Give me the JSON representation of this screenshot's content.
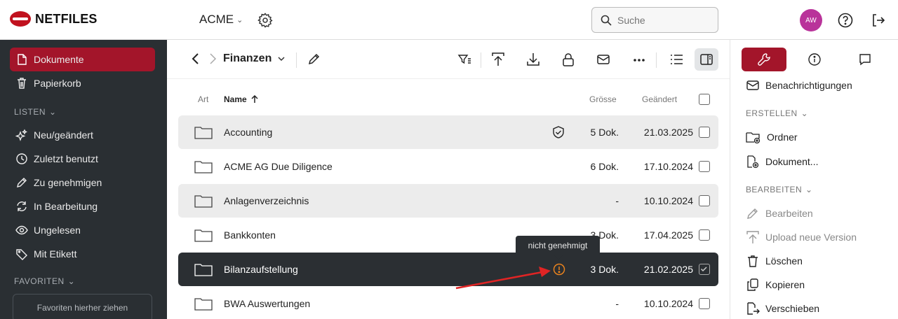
{
  "header": {
    "logo_text": "NETFILES",
    "org_name": "ACME",
    "search_placeholder": "Suche",
    "avatar_initials": "AW"
  },
  "sidebar": {
    "items": [
      {
        "label": "Dokumente",
        "icon": "document-icon",
        "active": true
      },
      {
        "label": "Papierkorb",
        "icon": "trash-icon"
      }
    ],
    "lists_heading": "LISTEN",
    "lists": [
      {
        "label": "Neu/geändert",
        "icon": "sparkle-icon"
      },
      {
        "label": "Zuletzt benutzt",
        "icon": "clock-icon"
      },
      {
        "label": "Zu genehmigen",
        "icon": "pencil-icon"
      },
      {
        "label": "In Bearbeitung",
        "icon": "sync-icon"
      },
      {
        "label": "Ungelesen",
        "icon": "eye-icon"
      },
      {
        "label": "Mit Etikett",
        "icon": "tag-icon"
      }
    ],
    "favorites_heading": "FAVORITEN",
    "favorites_dropzone": "Favoriten hierher ziehen"
  },
  "main": {
    "breadcrumb": "Finanzen",
    "columns": {
      "type": "Art",
      "name": "Name",
      "size": "Grösse",
      "changed": "Geändert"
    },
    "rows": [
      {
        "name": "Accounting",
        "size": "5 Dok.",
        "date": "21.03.2025",
        "status_icon": "shield-check-icon"
      },
      {
        "name": "ACME AG Due Diligence",
        "size": "6 Dok.",
        "date": "17.10.2024"
      },
      {
        "name": "Anlagenverzeichnis",
        "size": "-",
        "date": "10.10.2024"
      },
      {
        "name": "Bankkonten",
        "size": "3 Dok.",
        "date": "17.04.2025"
      },
      {
        "name": "Bilanzaufstellung",
        "size": "3 Dok.",
        "date": "21.02.2025",
        "status_icon": "warning-circle-icon",
        "selected": true
      },
      {
        "name": "BWA Auswertungen",
        "size": "-",
        "date": "10.10.2024"
      }
    ],
    "tooltip": "nicht genehmigt"
  },
  "rpanel": {
    "notifications": "Benachrichtigungen",
    "create_heading": "ERSTELLEN",
    "create_items": [
      "Ordner",
      "Dokument..."
    ],
    "edit_heading": "BEARBEITEN",
    "edit_items": [
      "Bearbeiten",
      "Upload neue Version",
      "Löschen",
      "Kopieren",
      "Verschieben"
    ]
  },
  "colors": {
    "brand": "#a3152a",
    "sidebar_bg": "#2a2f33",
    "warning": "#e8821e",
    "arrow": "#e02424"
  }
}
